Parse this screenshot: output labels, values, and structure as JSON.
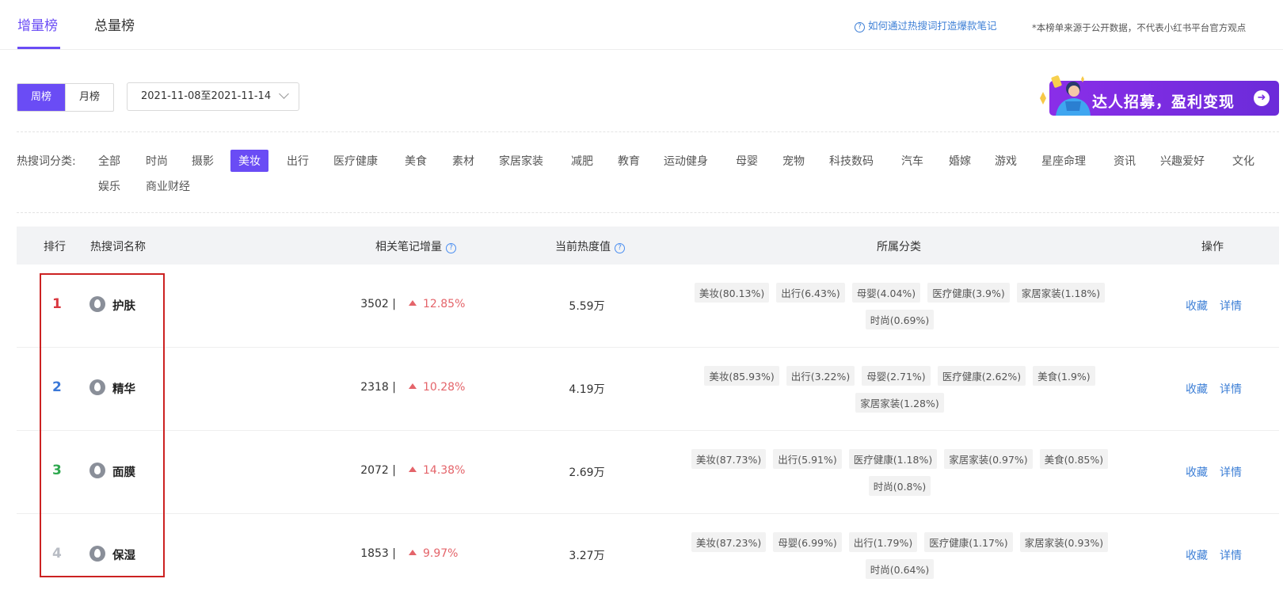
{
  "top_tabs": [
    {
      "label": "增量榜",
      "active": true
    },
    {
      "label": "总量榜",
      "active": false
    }
  ],
  "help_link": "如何通过热搜词打造爆款笔记",
  "disclaimer": "*本榜单来源于公开数据，不代表小红书平台官方观点",
  "period": {
    "options": [
      "周榜",
      "月榜"
    ],
    "selected": "周榜"
  },
  "date_range": "2021-11-08至2021-11-14",
  "banner": {
    "text": "达人招募，盈利变现"
  },
  "categories": {
    "label": "热搜词分类:",
    "items": [
      "全部",
      "时尚",
      "摄影",
      "美妆",
      "出行",
      "医疗健康",
      "美食",
      "素材",
      "家居家装",
      "减肥",
      "教育",
      "运动健身",
      "母婴",
      "宠物",
      "科技数码",
      "汽车",
      "婚嫁",
      "游戏",
      "星座命理",
      "资讯",
      "兴趣爱好",
      "文化",
      "娱乐",
      "商业财经"
    ],
    "selected": "美妆"
  },
  "table": {
    "headers": {
      "rank": "排行",
      "name": "热搜词名称",
      "notes": "相关笔记增量",
      "heat": "当前热度值",
      "category": "所属分类",
      "action": "操作"
    },
    "actions": {
      "fav": "收藏",
      "detail": "详情"
    },
    "rows": [
      {
        "rank": "1",
        "rank_color": "#d9363e",
        "keyword": "护肤",
        "notes": "3502 |",
        "growth": "12.85%",
        "heat": "5.59万",
        "cats": [
          "美妆(80.13%)",
          "出行(6.43%)",
          "母婴(4.04%)",
          "医疗健康(3.9%)",
          "家居家装(1.18%)",
          "时尚(0.69%)"
        ]
      },
      {
        "rank": "2",
        "rank_color": "#3b78d8",
        "keyword": "精华",
        "notes": "2318 |",
        "growth": "10.28%",
        "heat": "4.19万",
        "cats": [
          "美妆(85.93%)",
          "出行(3.22%)",
          "母婴(2.71%)",
          "医疗健康(2.62%)",
          "美食(1.9%)",
          "家居家装(1.28%)"
        ]
      },
      {
        "rank": "3",
        "rank_color": "#2fa84f",
        "keyword": "面膜",
        "notes": "2072 |",
        "growth": "14.38%",
        "heat": "2.69万",
        "cats": [
          "美妆(87.73%)",
          "出行(5.91%)",
          "医疗健康(1.18%)",
          "家居家装(0.97%)",
          "美食(0.85%)",
          "时尚(0.8%)"
        ]
      },
      {
        "rank": "4",
        "rank_color": "#b8bcc4",
        "keyword": "保湿",
        "notes": "1853 |",
        "growth": "9.97%",
        "heat": "3.27万",
        "cats": [
          "美妆(87.23%)",
          "母婴(6.99%)",
          "出行(1.79%)",
          "医疗健康(1.17%)",
          "家居家装(0.93%)",
          "时尚(0.64%)"
        ]
      }
    ]
  },
  "colors": {
    "accent": "#6a4cf5",
    "link": "#3d7fd6",
    "up": "#e4646a",
    "highlight": "#cc2222"
  }
}
